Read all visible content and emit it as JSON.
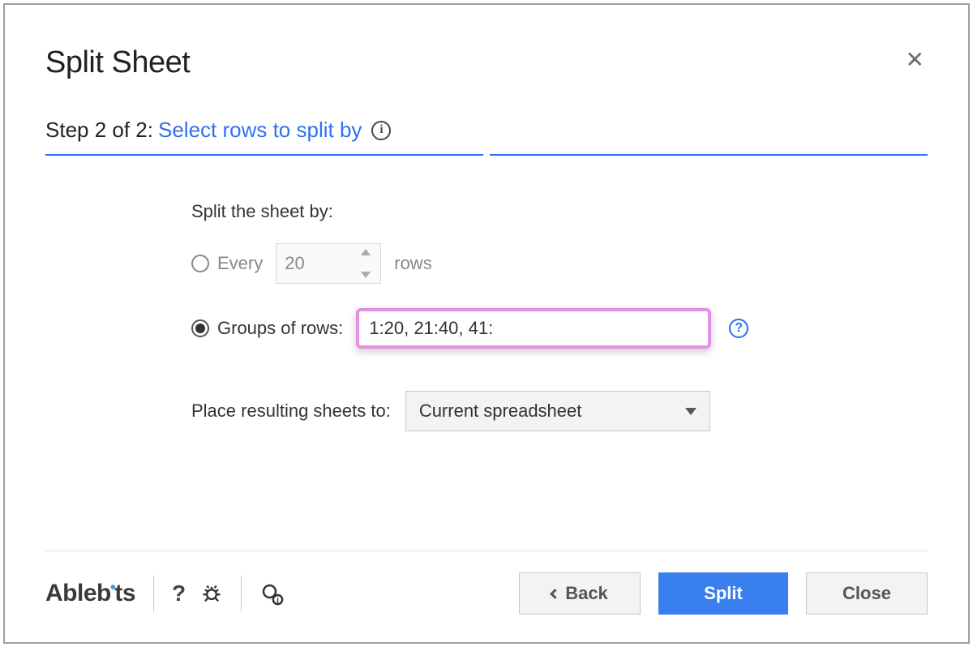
{
  "title": "Split Sheet",
  "step": {
    "lead": "Step 2 of 2:",
    "link": "Select rows to split by"
  },
  "form": {
    "section_label": "Split the sheet by:",
    "every_label": "Every",
    "every_value": "20",
    "rows_label": "rows",
    "groups_label": "Groups of rows:",
    "groups_value": "1:20, 21:40, 41:",
    "place_label": "Place resulting sheets to:",
    "place_value": "Current spreadsheet"
  },
  "footer": {
    "brand_left": "Ableb",
    "brand_right": "ts",
    "help_q": "?",
    "back": "Back",
    "split": "Split",
    "close": "Close"
  }
}
